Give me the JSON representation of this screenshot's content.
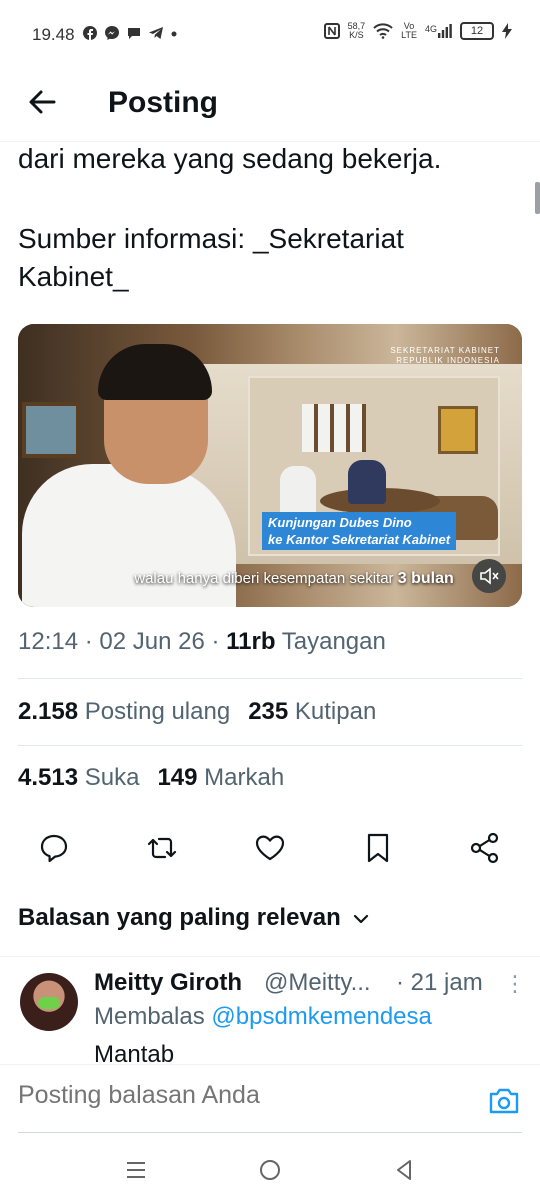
{
  "status_bar": {
    "time": "19.48",
    "net_speed_top": "58,7",
    "net_speed_bottom": "K/S",
    "volte_top": "Vo",
    "volte_bottom": "LTE",
    "network": "4G",
    "battery": "12"
  },
  "header": {
    "title": "Posting"
  },
  "post": {
    "text_line1": "dari mereka yang sedang bekerja.",
    "text_line2": "Sumber informasi: _Sekretariat Kabinet_",
    "media": {
      "brand_line1": "SEKRETARIAT KABINET",
      "brand_line2": "REPUBLIK INDONESIA",
      "caption_line1": "Kunjungan Dubes Dino",
      "caption_line2": "ke Kantor Sekretariat Kabinet",
      "subtitle_prefix": "walau hanya diberi kesempatan sekitar",
      "subtitle_bold": "3 bulan"
    },
    "time": "12:14",
    "date": "02 Jun 26",
    "views_count": "11rb",
    "views_label": "Tayangan",
    "reposts_count": "2.158",
    "reposts_label": "Posting ulang",
    "quotes_count": "235",
    "quotes_label": "Kutipan",
    "likes_count": "4.513",
    "likes_label": "Suka",
    "bookmarks_count": "149",
    "bookmarks_label": "Markah"
  },
  "replies_section": {
    "title": "Balasan yang paling relevan"
  },
  "reply": {
    "name": "Meitty Giroth",
    "handle": "@Meitty...",
    "time": "· 21 jam",
    "replying_prefix": "Membalas",
    "replying_to": "@bpsdmkemendesa",
    "text": "Mantab"
  },
  "composer": {
    "placeholder": "Posting balasan Anda"
  },
  "colors": {
    "accent": "#1d9bf0",
    "text": "#0f1419",
    "secondary": "#536471"
  },
  "icons": [
    "back-arrow-icon",
    "reply-icon",
    "repost-icon",
    "like-icon",
    "bookmark-icon",
    "share-icon",
    "camera-icon",
    "mute-icon",
    "chevron-down-icon",
    "recent-apps-icon",
    "home-icon",
    "back-nav-icon"
  ]
}
